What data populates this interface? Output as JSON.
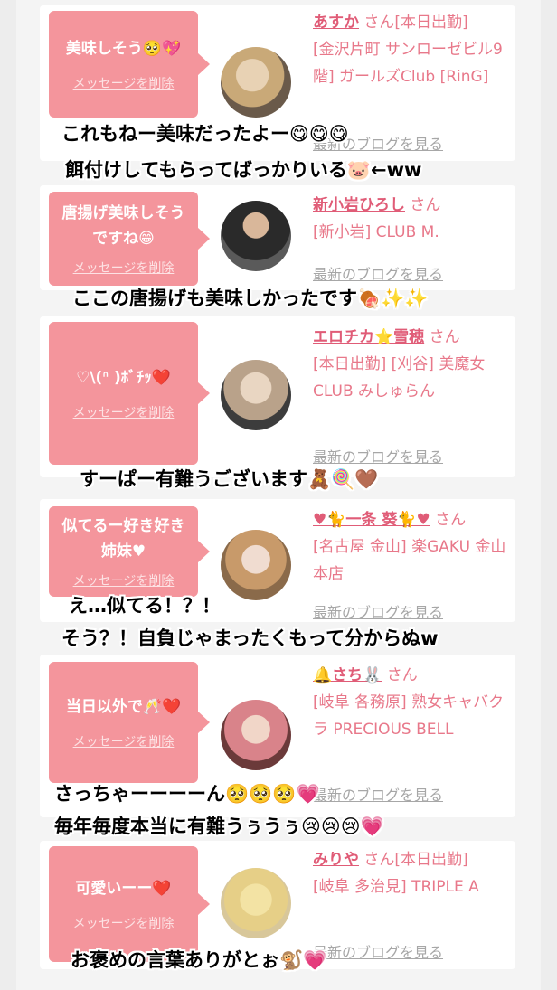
{
  "delete_label": "メッセージを削除",
  "blog_label": "最新のブログを見る",
  "san": "さん",
  "cards": [
    {
      "message": "美味しそう🥺💖",
      "name": "あすか",
      "status": "[本日出勤]",
      "location": "[金沢片町 サンローゼビル9階] ガールズClub [RinG]",
      "caption_1": "これもねー美味だったよー😋😋😋",
      "caption_2": "餌付けしてもらってばっかりいる🐷←ww"
    },
    {
      "message": "唐揚げ美味しそうですね😁",
      "name": "新小岩ひろし",
      "status": "",
      "location": "[新小岩] CLUB M.",
      "caption_1": "ここの唐揚げも美味しかったです🍖✨✨"
    },
    {
      "message": "♡\\(ᐢ )ﾎﾞﾁｯ❤️",
      "name": "エロチカ⭐雪穂",
      "status": "",
      "location": "[本日出勤] [刈谷] 美魔女CLUB みしゅらん",
      "caption_1": "すーぱー有難うございます🧸🍭🤎"
    },
    {
      "message": "似てるー好き好き姉妹♥",
      "name": "♥🐈一条 葵🐈♥",
      "status": "",
      "location": "[名古屋 金山] 楽GAKU 金山本店",
      "caption_1": "え…似てる！？！",
      "caption_2": "そう？！自負じゃまったくもって分からぬw"
    },
    {
      "message": "当日以外で🥂❤️",
      "name": "🔔さち🐰",
      "status": "",
      "location": "[岐阜 各務原] 熟女キャバクラ PRECIOUS BELL",
      "caption_1": "さっちゃーーーーん🥺🥺🥺💗",
      "caption_2": "毎年毎度本当に有難うぅうぅ😢😢😢💗"
    },
    {
      "message": "可愛いーー❤️",
      "name": "みりや",
      "status": "[本日出勤]",
      "location": "[岐阜 多治見] TRIPLE A",
      "caption_1": "お褒めの言葉ありがとぉ🐒💗"
    }
  ]
}
